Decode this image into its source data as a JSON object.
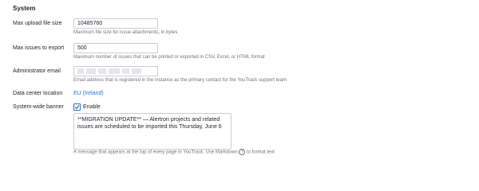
{
  "section": {
    "title": "System"
  },
  "upload": {
    "label": "Max upload file size",
    "value": "10485760",
    "hint": "Maximum file size for issue attachments, in bytes"
  },
  "export": {
    "label": "Max issues to export",
    "value": "500",
    "hint": "Maximum number of issues that can be printed or exported in CSV, Excel, or HTML format"
  },
  "admin_email": {
    "label": "Administrator email",
    "value": "",
    "hint": "Email address that is registered in the instance as the primary contact for the YouTrack support team"
  },
  "data_center": {
    "label": "Data center location",
    "value": "EU (Ireland)"
  },
  "banner": {
    "label": "System-wide banner",
    "enable_label": "Enable",
    "enabled": true,
    "text": "**MIGRATION UPDATE** — Alertron projects and related issues are scheduled to be imported this Thursday, June 6",
    "hint_before": "A message that appears at the top of every page in YouTrack. Use Markdown",
    "help_icon": "question-circle-icon",
    "hint_after": "to format text"
  },
  "colors": {
    "link": "#2a6fdb",
    "hint": "#737577",
    "border": "#c9ced6"
  }
}
